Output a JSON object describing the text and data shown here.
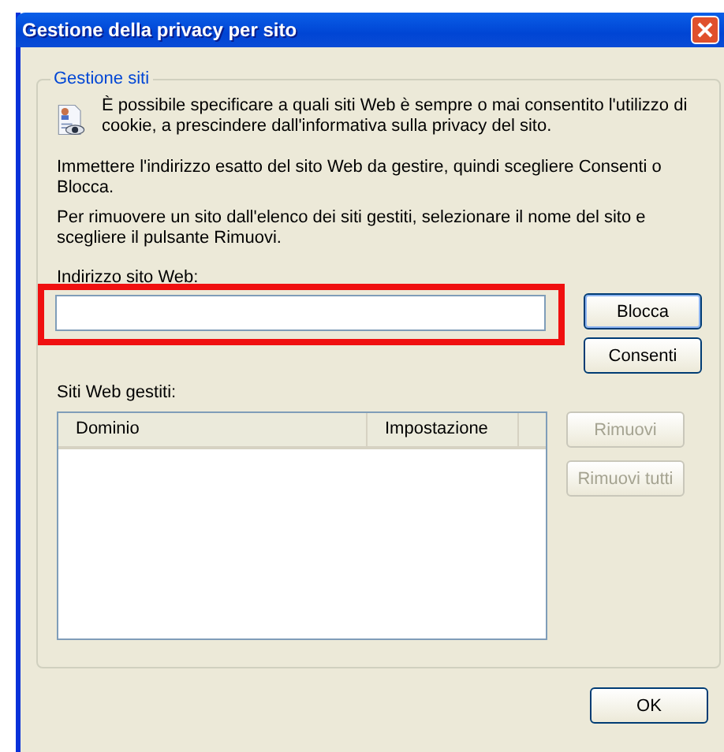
{
  "window": {
    "title": "Gestione della privacy per sito"
  },
  "group": {
    "title": "Gestione siti",
    "intro": "È possibile specificare a quali siti Web è sempre o mai consentito l'utilizzo di cookie, a prescindere dall'informativa sulla privacy del sito.",
    "paragraphs": [
      "Immettere l'indirizzo esatto del sito Web da gestire, quindi scegliere Consenti o Blocca.",
      "Per rimuovere un sito dall'elenco dei siti gestiti, selezionare il nome del sito e scegliere il pulsante Rimuovi."
    ],
    "address": {
      "label": "Indirizzo sito Web:",
      "highlighted": true
    },
    "address_buttons": [
      {
        "label": "Blocca",
        "disabled": false,
        "default": true
      },
      {
        "label": "Consenti",
        "disabled": false,
        "default": false
      }
    ],
    "list": {
      "label": "Siti Web gestiti:",
      "columns": [
        "Dominio",
        "Impostazione"
      ]
    },
    "list_buttons": [
      {
        "label": "Rimuovi",
        "disabled": true,
        "default": false
      },
      {
        "label": "Rimuovi tutti",
        "disabled": true,
        "default": false
      }
    ]
  },
  "buttons": [
    {
      "label": "OK",
      "disabled": false,
      "default": false
    }
  ]
}
